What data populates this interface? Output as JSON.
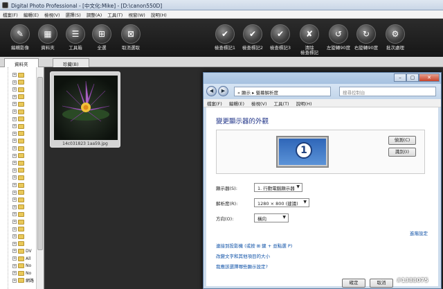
{
  "window": {
    "title": "Digital Photo Professional - [中文化:Mike] - [D:\\canon550D]"
  },
  "menu": [
    "檔案(F)",
    "編輯(E)",
    "檢視(V)",
    "選擇(S)",
    "調整(A)",
    "工具(T)",
    "視窗(W)",
    "說明(H)"
  ],
  "toolbar": [
    {
      "label": "編輯影像",
      "icon": "edit-image-icon",
      "glyph": "✎"
    },
    {
      "label": "資料夾",
      "icon": "folder-icon",
      "glyph": "▦"
    },
    {
      "label": "工具箱",
      "icon": "toolbox-icon",
      "glyph": "☰"
    },
    {
      "label": "全選",
      "icon": "select-all-icon",
      "glyph": "⊞"
    },
    {
      "label": "取消選取",
      "icon": "deselect-icon",
      "glyph": "⊠"
    },
    {
      "label": "檢查標記1",
      "icon": "check-mark-1-icon",
      "glyph": "✔"
    },
    {
      "label": "檢查標記2",
      "icon": "check-mark-2-icon",
      "glyph": "✔"
    },
    {
      "label": "檢查標記3",
      "icon": "check-mark-3-icon",
      "glyph": "✔"
    },
    {
      "label": "清除\n檢查標記",
      "icon": "clear-check-mark-icon",
      "glyph": "✘"
    },
    {
      "label": "左旋轉90度",
      "icon": "rotate-left-icon",
      "glyph": "↺"
    },
    {
      "label": "右旋轉90度",
      "icon": "rotate-right-icon",
      "glyph": "↻"
    },
    {
      "label": "批次處理",
      "icon": "batch-process-icon",
      "glyph": "⚙"
    }
  ],
  "tabs": [
    "資料夾",
    "珍藏(B)"
  ],
  "tree": {
    "items": [
      {
        "label": ""
      },
      {
        "label": ""
      },
      {
        "label": ""
      },
      {
        "label": ""
      },
      {
        "label": ""
      },
      {
        "label": ""
      },
      {
        "label": ""
      },
      {
        "label": ""
      },
      {
        "label": ""
      },
      {
        "label": ""
      },
      {
        "label": ""
      },
      {
        "label": ""
      },
      {
        "label": ""
      },
      {
        "label": ""
      },
      {
        "label": ""
      },
      {
        "label": ""
      },
      {
        "label": ""
      },
      {
        "label": ""
      },
      {
        "label": ""
      },
      {
        "label": ""
      },
      {
        "label": ""
      },
      {
        "label": ""
      },
      {
        "label": ""
      },
      {
        "label": ""
      },
      {
        "label": "DV"
      },
      {
        "label": "All"
      },
      {
        "label": "No"
      },
      {
        "label": "No"
      },
      {
        "label": "網路"
      }
    ]
  },
  "thumbnail": {
    "filename": "14c031823 1aa59.jpg"
  },
  "dialog": {
    "address": "« 顯示 ▸ 螢幕解析度",
    "search_placeholder": "搜尋控制台",
    "menu": [
      "檔案(F)",
      "編輯(E)",
      "檢視(V)",
      "工具(T)",
      "說明(H)"
    ],
    "heading": "變更顯示器的外觀",
    "monitor_number": "1",
    "detect_button": "偵測(C)",
    "identify_button": "識別(I)",
    "display_label": "顯示器(S):",
    "display_value": "1. 行動電腦顯示器",
    "resolution_label": "解析度(R):",
    "resolution_value": "1280 × 800 (建議)",
    "orientation_label": "方向(O):",
    "orientation_value": "橫向",
    "advanced_link": "進階設定",
    "projector_link": "連接到投影機 (或按 ⊞ 鍵 + 並點選 P)",
    "text_size_link": "改變文字和其他項目的大小",
    "help_link": "我應該選擇哪些顯示設定?",
    "ok_button": "確定",
    "cancel_button": "取消"
  },
  "watermark": "#1388075"
}
